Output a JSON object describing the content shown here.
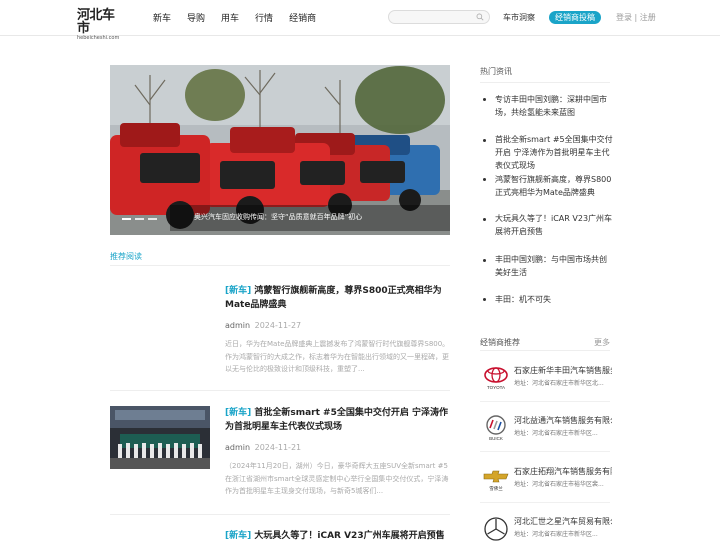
{
  "header": {
    "logo_text": "河北车市",
    "logo_sub": "hebeicheshi.com",
    "nav": [
      "新车",
      "导购",
      "用车",
      "行情",
      "经销商"
    ],
    "search_placeholder": "",
    "insight_label": "车市洞察",
    "dealer_button": "经销商投稿",
    "login": "登录",
    "register": "注册"
  },
  "carousel": {
    "caption": "奥兴汽车固应收购传闻：坚守“品质意就百年品牌”初心"
  },
  "feed": {
    "section_title": "推荐阅读",
    "articles": [
      {
        "tag": "[新车]",
        "title": "鸿蒙智行旗舰新高度，尊界S800正式亮相华为Mate品牌盛典",
        "author": "admin",
        "date": "2024-11-27",
        "summary": "近日，华为在Mate品牌盛典上震撼发布了鸿蒙智行时代旗舰尊界S800。作为鸿蒙智行的大成之作，标志着华为在智能出行领域的又一里程碑，更以无与伦比的极致设计和顶级科技，重塑了..."
      },
      {
        "tag": "[新车]",
        "title": "首批全新smart #5全国集中交付开启 宁泽涛作为首批明星车主代表仪式现场",
        "author": "admin",
        "date": "2024-11-21",
        "summary": "（2024年11月20日，湖州）今日，豪华奇辉大五座SUV全新smart #5在浙江省湖州市smart全球灵感定制中心举行全国集中交付仪式，宁泽涛作为首批明星车主现身交付现场，与新奇5城客们..."
      },
      {
        "tag": "[新车]",
        "title": "大玩具久等了！iCAR V23广州车展将开启预售",
        "author": "",
        "date": "",
        "summary": ""
      }
    ]
  },
  "sidebar": {
    "hot_title": "热门资讯",
    "hot_items": [
      "专访丰田中国刘鹏：深耕中国市场，共绘氢能未来蓝图",
      "首批全新smart #5全国集中交付开启 宁泽涛作为首批明星车主代表仪式现场",
      "鸿蒙智行旗舰新高度，尊界S800正式亮相华为Mate品牌盛典",
      "大玩具久等了！iCAR V23广州车展将开启预售",
      "丰田中国刘鹏：与中国市场共创美好生活",
      "丰田：机不可失"
    ],
    "dealer_title": "经销商推荐",
    "more": "更多",
    "dealers": [
      {
        "name": "石家庄新华丰田汽车销售服务",
        "addr": "地址：河北省石家庄市新华区北...",
        "brand": "TOYOTA"
      },
      {
        "name": "河北益通汽车销售服务有限公司",
        "addr": "地址：河北省石家庄市新华区...",
        "brand": "BUICK"
      },
      {
        "name": "石家庄拓翔汽车销售服务有限公司",
        "addr": "地址：河北省石家庄市裕华区裴...",
        "brand": "雪佛兰"
      },
      {
        "name": "河北汇世之星汽车贸易有限公司",
        "addr": "地址：河北省石家庄市新华区...",
        "brand": ""
      }
    ]
  },
  "colors": {
    "accent": "#1aa4c8",
    "text": "#333333",
    "muted": "#aaaaaa"
  }
}
